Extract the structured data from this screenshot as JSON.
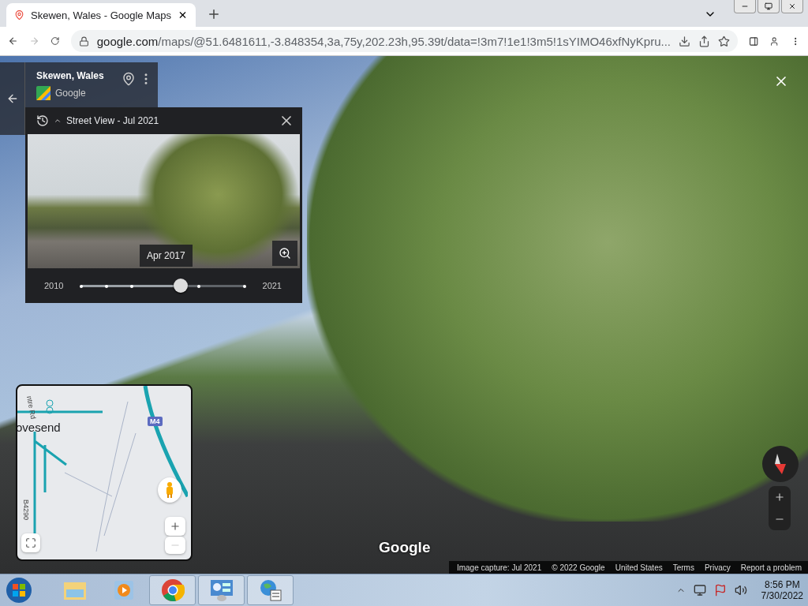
{
  "browser": {
    "tab": {
      "title": "Skewen, Wales - Google Maps",
      "selected": true
    },
    "url_host": "google.com",
    "url_path": "/maps/@51.6481611,-3.848354,3a,75y,202.23h,95.39t/data=!3m7!1e1!3m5!1sYIMO46xfNyKpru..."
  },
  "place_card": {
    "title": "Skewen, Wales",
    "source": "Google"
  },
  "time_panel": {
    "title": "Street View - Jul 2021",
    "preview_date": "Apr 2017",
    "start_year": "2010",
    "end_year": "2021",
    "level": 0.61
  },
  "minimap": {
    "labels": [
      {
        "text": "ovesend",
        "kind": "place"
      },
      {
        "text": "ntre Rd",
        "kind": "road"
      },
      {
        "text": "M4",
        "kind": "shield"
      },
      {
        "text": "B4290",
        "kind": "road"
      }
    ]
  },
  "watermark_logo": "Google",
  "footer": [
    "Image capture: Jul 2021",
    "© 2022 Google",
    "United States",
    "Terms",
    "Privacy",
    "Report a problem"
  ],
  "taskbar": {
    "apps": [
      {
        "kind": "explorer",
        "running": false
      },
      {
        "kind": "media",
        "running": false
      },
      {
        "kind": "chrome",
        "running": true
      },
      {
        "kind": "control",
        "running": true
      },
      {
        "kind": "network",
        "running": true
      }
    ],
    "time": "8:56 PM",
    "date": "7/30/2022"
  }
}
